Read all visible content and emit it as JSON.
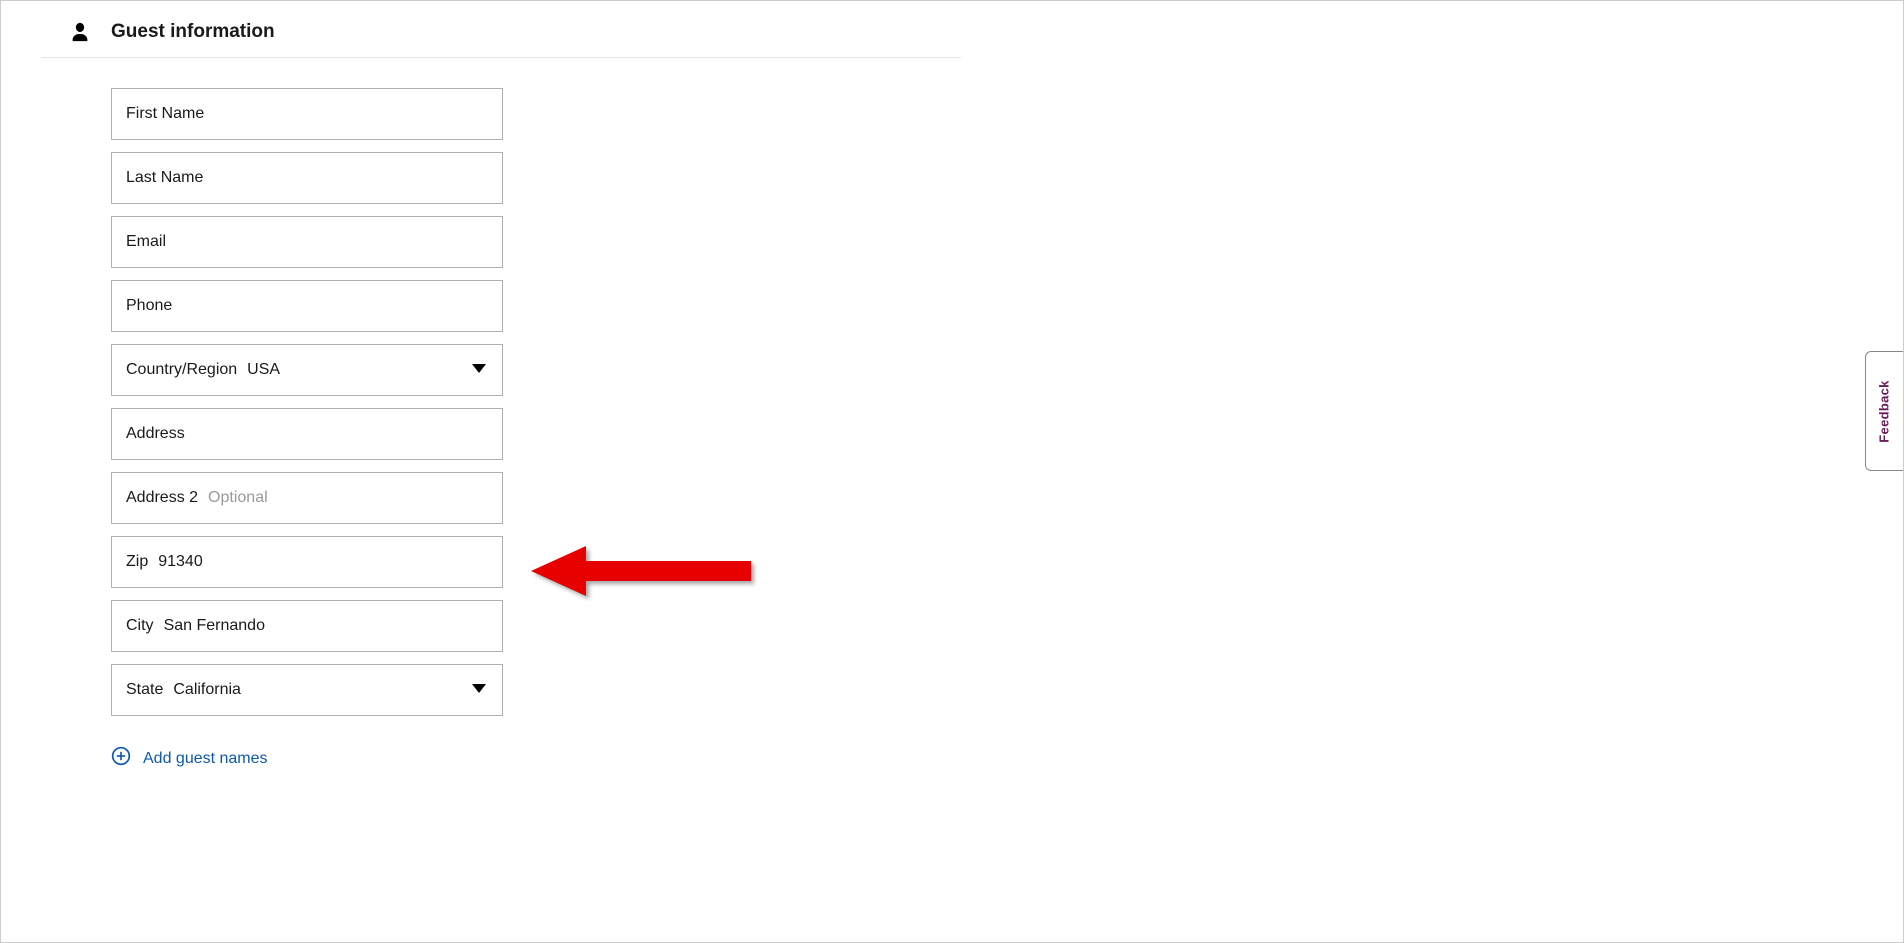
{
  "section": {
    "title": "Guest information"
  },
  "fields": {
    "firstName": {
      "label": "First Name",
      "value": ""
    },
    "lastName": {
      "label": "Last Name",
      "value": ""
    },
    "email": {
      "label": "Email",
      "value": ""
    },
    "phone": {
      "label": "Phone",
      "value": ""
    },
    "country": {
      "label": "Country/Region",
      "value": "USA"
    },
    "address": {
      "label": "Address",
      "value": ""
    },
    "address2": {
      "label": "Address 2",
      "placeholder": "Optional",
      "value": ""
    },
    "zip": {
      "label": "Zip",
      "value": "91340"
    },
    "city": {
      "label": "City",
      "value": "San Fernando"
    },
    "state": {
      "label": "State",
      "value": "California"
    }
  },
  "addGuest": {
    "label": "Add guest names"
  },
  "feedback": {
    "label": "Feedback"
  },
  "annotation": {
    "arrow_color": "#e60000"
  }
}
